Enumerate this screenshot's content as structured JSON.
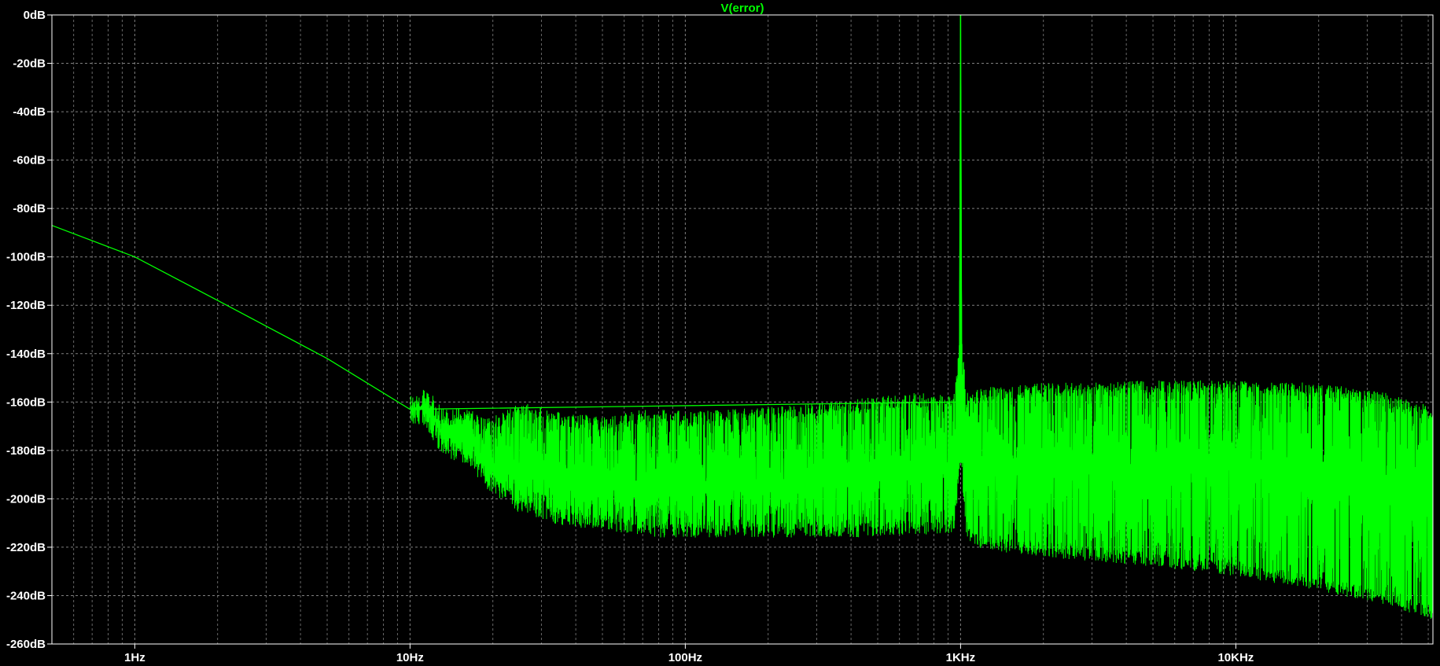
{
  "chart_data": {
    "type": "line",
    "title": "V(error)",
    "xscale": "log",
    "xlim": [
      0.5,
      52000
    ],
    "ylim": [
      -260,
      0
    ],
    "grid": true,
    "background_color": "#000000",
    "grid_color": "#808080",
    "axis_color": "#ffffff",
    "y_ticks": [
      "0dB",
      "-20dB",
      "-40dB",
      "-60dB",
      "-80dB",
      "-100dB",
      "-120dB",
      "-140dB",
      "-160dB",
      "-180dB",
      "-200dB",
      "-220dB",
      "-240dB",
      "-260dB"
    ],
    "x_ticks": [
      "1Hz",
      "10Hz",
      "100Hz",
      "1KHz",
      "10KHz"
    ],
    "series": [
      {
        "color": "#00ff00",
        "x": [
          0.5,
          1,
          2,
          5,
          10,
          11.5,
          13,
          16,
          19,
          25,
          35,
          50,
          80,
          100,
          200,
          400,
          700,
          950,
          990,
          1000,
          1010,
          1050,
          1200,
          2000,
          5000,
          10000,
          20000,
          35000,
          52000
        ],
        "y": [
          -87,
          -100,
          -118,
          -142,
          -163,
          -162,
          -172,
          -174,
          -186,
          -190,
          -193,
          -196,
          -196,
          -196,
          -194,
          -192,
          -190,
          -185,
          -160,
          0,
          -160,
          -185,
          -188,
          -188,
          -187,
          -186,
          -188,
          -192,
          -198
        ],
        "upper": [
          -87,
          -100,
          -118,
          -142,
          -163,
          -160,
          -168,
          -168,
          -173,
          -166,
          -170,
          -172,
          -168,
          -170,
          -168,
          -165,
          -162,
          -162,
          -140,
          0,
          -140,
          -162,
          -160,
          -158,
          -157,
          -157,
          -158,
          -162,
          -168
        ],
        "lower": [
          -87,
          -100,
          -118,
          -142,
          -163,
          -165,
          -176,
          -180,
          -190,
          -200,
          -205,
          -207,
          -210,
          -210,
          -210,
          -210,
          -209,
          -208,
          -185,
          0,
          -185,
          -212,
          -215,
          -218,
          -222,
          -226,
          -232,
          -238,
          -244
        ]
      }
    ]
  }
}
